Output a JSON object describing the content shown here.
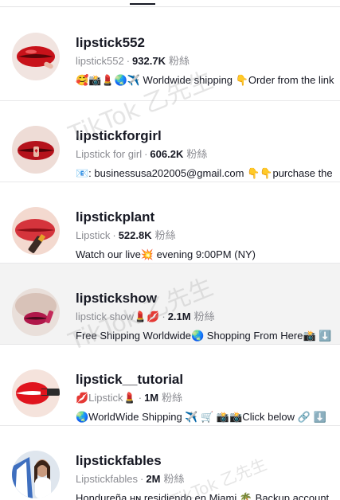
{
  "results": [
    {
      "username": "lipstick552",
      "nickname": "lipstick552",
      "followers": "932.7K",
      "fans_label": "粉絲",
      "bio": "🥰📸💄🌏✈️ Worldwide shipping 👇Order from the link"
    },
    {
      "username": "lipstickforgirl",
      "nickname": "Lipstick for girl",
      "followers": "606.2K",
      "fans_label": "粉絲",
      "bio": "📧: businessusa202005@gmail.com 👇👇purchase the"
    },
    {
      "username": "lipstickplant",
      "nickname": "Lipstick",
      "followers": "522.8K",
      "fans_label": "粉絲",
      "bio": "Watch our live💥 evening 9:00PM (NY)"
    },
    {
      "username": "lipstickshow",
      "nickname": "lipstick show💄💋",
      "followers": "2.1M",
      "fans_label": "粉絲",
      "bio": "Free Shipping Worldwide🌏 Shopping From Here📸 ⬇️"
    },
    {
      "username": "lipstick__tutorial",
      "nickname": "💋Lipstick💄",
      "followers": "1M",
      "fans_label": "粉絲",
      "bio": "🌏WorldWide Shipping ✈️ 🛒 📸📸Click below 🔗 ⬇️"
    },
    {
      "username": "lipstickfables",
      "nickname": "Lipstickfables",
      "followers": "2M",
      "fans_label": "粉絲",
      "bio": "Hondureña ʜɴ residiendo en Miami 🌴 Backup account"
    }
  ],
  "watermark": "TikTok 乙先生",
  "colors": {
    "primary_text": "#161823",
    "secondary_text": "#8a8b91",
    "highlight_row": "#f3f3f3"
  }
}
